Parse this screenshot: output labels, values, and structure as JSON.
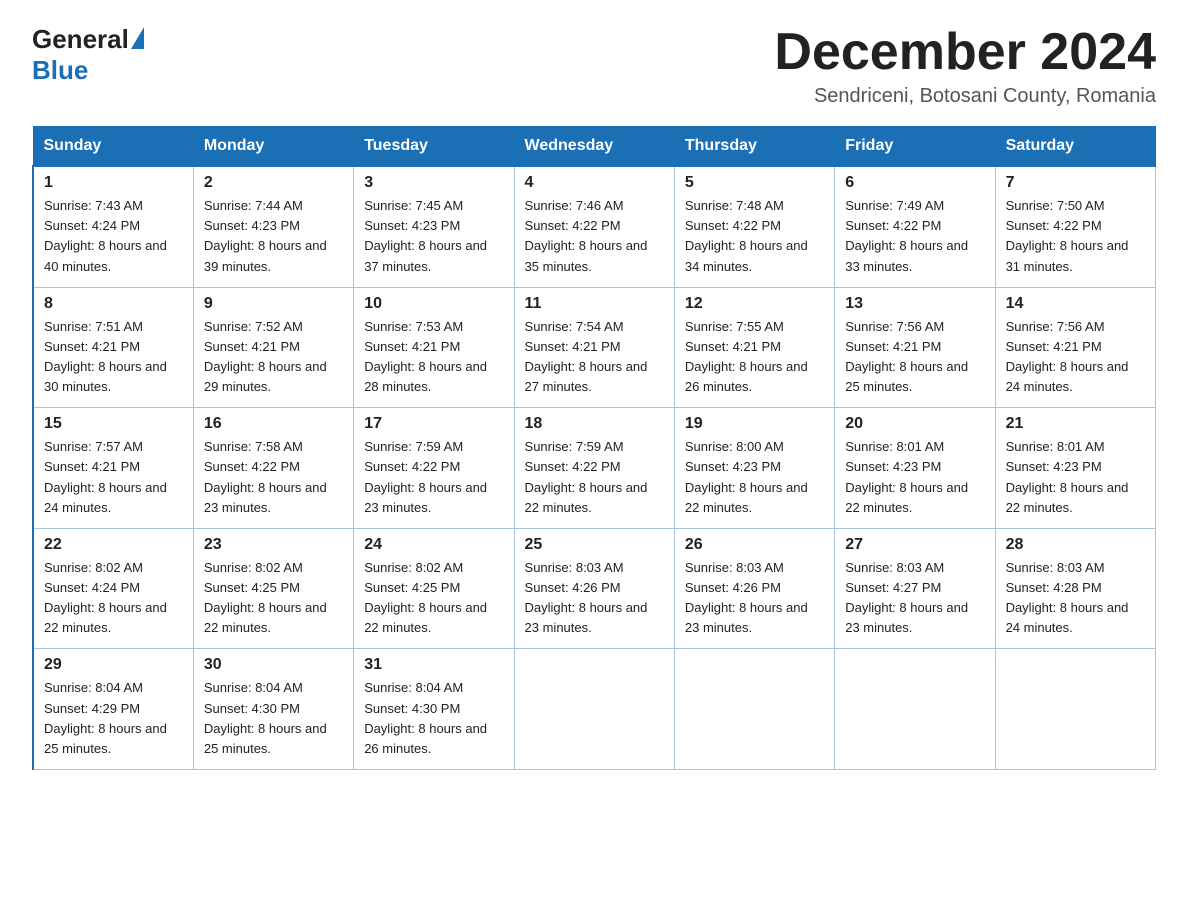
{
  "header": {
    "logo_general": "General",
    "logo_blue": "Blue",
    "month_title": "December 2024",
    "location": "Sendriceni, Botosani County, Romania"
  },
  "weekdays": [
    "Sunday",
    "Monday",
    "Tuesday",
    "Wednesday",
    "Thursday",
    "Friday",
    "Saturday"
  ],
  "weeks": [
    [
      {
        "day": "1",
        "sunrise": "7:43 AM",
        "sunset": "4:24 PM",
        "daylight": "8 hours and 40 minutes."
      },
      {
        "day": "2",
        "sunrise": "7:44 AM",
        "sunset": "4:23 PM",
        "daylight": "8 hours and 39 minutes."
      },
      {
        "day": "3",
        "sunrise": "7:45 AM",
        "sunset": "4:23 PM",
        "daylight": "8 hours and 37 minutes."
      },
      {
        "day": "4",
        "sunrise": "7:46 AM",
        "sunset": "4:22 PM",
        "daylight": "8 hours and 35 minutes."
      },
      {
        "day": "5",
        "sunrise": "7:48 AM",
        "sunset": "4:22 PM",
        "daylight": "8 hours and 34 minutes."
      },
      {
        "day": "6",
        "sunrise": "7:49 AM",
        "sunset": "4:22 PM",
        "daylight": "8 hours and 33 minutes."
      },
      {
        "day": "7",
        "sunrise": "7:50 AM",
        "sunset": "4:22 PM",
        "daylight": "8 hours and 31 minutes."
      }
    ],
    [
      {
        "day": "8",
        "sunrise": "7:51 AM",
        "sunset": "4:21 PM",
        "daylight": "8 hours and 30 minutes."
      },
      {
        "day": "9",
        "sunrise": "7:52 AM",
        "sunset": "4:21 PM",
        "daylight": "8 hours and 29 minutes."
      },
      {
        "day": "10",
        "sunrise": "7:53 AM",
        "sunset": "4:21 PM",
        "daylight": "8 hours and 28 minutes."
      },
      {
        "day": "11",
        "sunrise": "7:54 AM",
        "sunset": "4:21 PM",
        "daylight": "8 hours and 27 minutes."
      },
      {
        "day": "12",
        "sunrise": "7:55 AM",
        "sunset": "4:21 PM",
        "daylight": "8 hours and 26 minutes."
      },
      {
        "day": "13",
        "sunrise": "7:56 AM",
        "sunset": "4:21 PM",
        "daylight": "8 hours and 25 minutes."
      },
      {
        "day": "14",
        "sunrise": "7:56 AM",
        "sunset": "4:21 PM",
        "daylight": "8 hours and 24 minutes."
      }
    ],
    [
      {
        "day": "15",
        "sunrise": "7:57 AM",
        "sunset": "4:21 PM",
        "daylight": "8 hours and 24 minutes."
      },
      {
        "day": "16",
        "sunrise": "7:58 AM",
        "sunset": "4:22 PM",
        "daylight": "8 hours and 23 minutes."
      },
      {
        "day": "17",
        "sunrise": "7:59 AM",
        "sunset": "4:22 PM",
        "daylight": "8 hours and 23 minutes."
      },
      {
        "day": "18",
        "sunrise": "7:59 AM",
        "sunset": "4:22 PM",
        "daylight": "8 hours and 22 minutes."
      },
      {
        "day": "19",
        "sunrise": "8:00 AM",
        "sunset": "4:23 PM",
        "daylight": "8 hours and 22 minutes."
      },
      {
        "day": "20",
        "sunrise": "8:01 AM",
        "sunset": "4:23 PM",
        "daylight": "8 hours and 22 minutes."
      },
      {
        "day": "21",
        "sunrise": "8:01 AM",
        "sunset": "4:23 PM",
        "daylight": "8 hours and 22 minutes."
      }
    ],
    [
      {
        "day": "22",
        "sunrise": "8:02 AM",
        "sunset": "4:24 PM",
        "daylight": "8 hours and 22 minutes."
      },
      {
        "day": "23",
        "sunrise": "8:02 AM",
        "sunset": "4:25 PM",
        "daylight": "8 hours and 22 minutes."
      },
      {
        "day": "24",
        "sunrise": "8:02 AM",
        "sunset": "4:25 PM",
        "daylight": "8 hours and 22 minutes."
      },
      {
        "day": "25",
        "sunrise": "8:03 AM",
        "sunset": "4:26 PM",
        "daylight": "8 hours and 23 minutes."
      },
      {
        "day": "26",
        "sunrise": "8:03 AM",
        "sunset": "4:26 PM",
        "daylight": "8 hours and 23 minutes."
      },
      {
        "day": "27",
        "sunrise": "8:03 AM",
        "sunset": "4:27 PM",
        "daylight": "8 hours and 23 minutes."
      },
      {
        "day": "28",
        "sunrise": "8:03 AM",
        "sunset": "4:28 PM",
        "daylight": "8 hours and 24 minutes."
      }
    ],
    [
      {
        "day": "29",
        "sunrise": "8:04 AM",
        "sunset": "4:29 PM",
        "daylight": "8 hours and 25 minutes."
      },
      {
        "day": "30",
        "sunrise": "8:04 AM",
        "sunset": "4:30 PM",
        "daylight": "8 hours and 25 minutes."
      },
      {
        "day": "31",
        "sunrise": "8:04 AM",
        "sunset": "4:30 PM",
        "daylight": "8 hours and 26 minutes."
      },
      null,
      null,
      null,
      null
    ]
  ],
  "labels": {
    "sunrise": "Sunrise: ",
    "sunset": "Sunset: ",
    "daylight": "Daylight: "
  }
}
